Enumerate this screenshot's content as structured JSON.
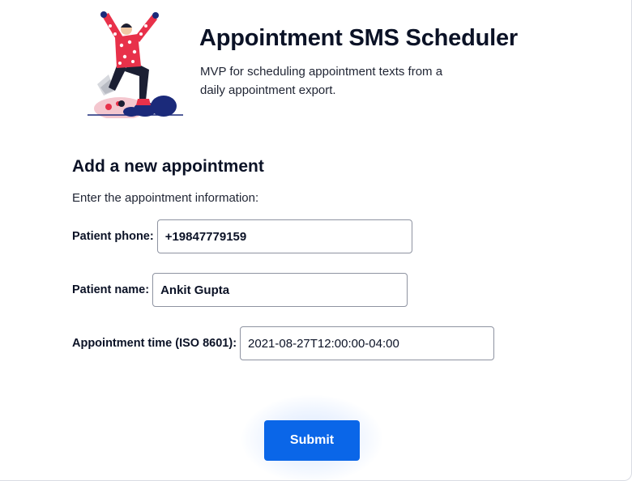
{
  "header": {
    "title": "Appointment SMS Scheduler",
    "subtitle": "MVP for scheduling appointment texts from a daily appointment export."
  },
  "illustration": {
    "icon": "person-celebrating-illustration"
  },
  "form": {
    "heading": "Add a new appointment",
    "intro": "Enter the appointment information:",
    "phone": {
      "label": "Patient phone:",
      "value": "+19847779159"
    },
    "name": {
      "label": "Patient name:",
      "value": "Ankit Gupta"
    },
    "time": {
      "label": "Appointment time (ISO 8601):",
      "value": "2021-08-27T12:00:00-04:00"
    },
    "submit_label": "Submit"
  },
  "colors": {
    "accent": "#0a66e8",
    "text": "#0b1226",
    "illustration_red": "#e8314a",
    "illustration_navy": "#1b2a7a",
    "illustration_pink": "#f4c7cf"
  }
}
